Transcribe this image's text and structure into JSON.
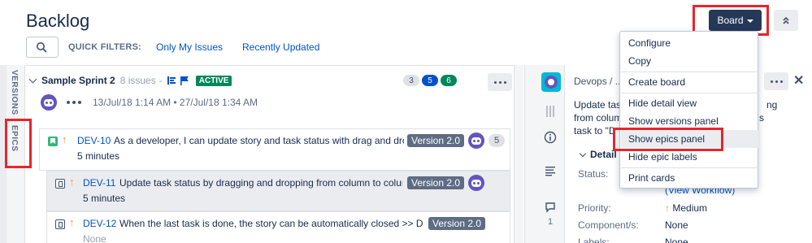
{
  "header": {
    "title": "Backlog",
    "quick_filters_label": "QUICK FILTERS:",
    "filters": [
      "Only My Issues",
      "Recently Updated"
    ],
    "board_button": "Board"
  },
  "left_tabs": {
    "versions": "VERSIONS",
    "epics": "EPICS"
  },
  "sprint": {
    "name": "Sample Sprint 2",
    "issue_count": "8 issues",
    "separator": "-",
    "status": "ACTIVE",
    "counts": [
      "3",
      "5",
      "6"
    ],
    "dates": "13/Jul/18 1:14 AM • 27/Jul/18 1:34 AM"
  },
  "issues": [
    {
      "key": "DEV-10",
      "summary": "As a developer, I can update story and task status with drag and dro",
      "estimate": "5 minutes",
      "version": "Version 2.0",
      "points": "5"
    },
    {
      "key": "DEV-11",
      "summary": "Update task status by dragging and dropping from column to colur",
      "estimate": "5 minutes",
      "version": "Version 2.0"
    },
    {
      "key": "DEV-12",
      "summary": "When the last task is done, the story can be automatically closed >> Dra",
      "estimate": "None",
      "version": "Version 2.0"
    }
  ],
  "detail": {
    "breadcrumb": "Devops / ...",
    "description_lines": [
      "Update tas",
      "from colum",
      "task to \"D"
    ],
    "description_right": [
      "ng",
      "s"
    ],
    "details_heading": "Detail",
    "comment_count": "1",
    "status_label": "Status:",
    "view_workflow": "(View Workflow)",
    "priority_label": "Priority:",
    "priority_value": "Medium",
    "components_label": "Component/s:",
    "components_value": "None",
    "labels_label": "Labels:",
    "labels_value": "None"
  },
  "menu": {
    "items": [
      "Configure",
      "Copy",
      "Create board",
      "Hide detail view",
      "Show versions panel",
      "Show epics panel",
      "Hide epic labels",
      "Print cards"
    ]
  },
  "colors": {
    "highlight": "#e9242a",
    "board_button": "#253858",
    "active": "#00875a",
    "link": "#0052cc"
  }
}
